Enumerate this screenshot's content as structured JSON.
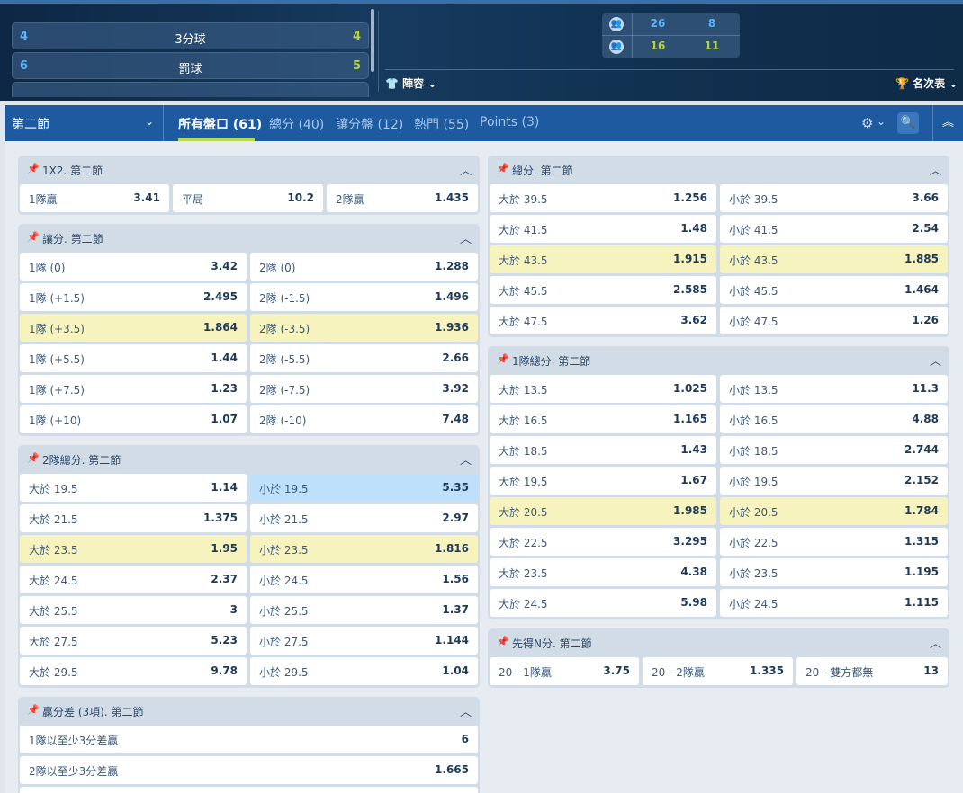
{
  "colors": {
    "nav": "#1d5aa0",
    "active_tab_underline": "#b9d94a",
    "highlight_row": "#f7f3be",
    "selected_cell": "#bfe0fb"
  },
  "stats": [
    {
      "home": "4",
      "label": "3分球",
      "away": "4"
    },
    {
      "home": "6",
      "label": "罰球",
      "away": "5"
    }
  ],
  "scoreboard": {
    "rows": [
      {
        "home": "26",
        "away": "8"
      },
      {
        "home": "16",
        "away": "11"
      }
    ]
  },
  "top_links": {
    "lineup": "陣容",
    "standings": "名次表"
  },
  "nav": {
    "period": "第二節",
    "tabs": [
      "所有盤口 (61)",
      "總分 (40)",
      "讓分盤 (12)",
      "熱門 (55)",
      "Points (3)"
    ]
  },
  "markets": {
    "m1x2": {
      "title": "1X2. 第二節",
      "cells": [
        {
          "n": "1隊贏",
          "o": "3.41"
        },
        {
          "n": "平局",
          "o": "10.2"
        },
        {
          "n": "2隊贏",
          "o": "1.435"
        }
      ]
    },
    "handicap": {
      "title": "讓分. 第二節",
      "rows": [
        [
          {
            "n": "1隊 (0)",
            "o": "3.42"
          },
          {
            "n": "2隊 (0)",
            "o": "1.288"
          }
        ],
        [
          {
            "n": "1隊 (+1.5)",
            "o": "2.495"
          },
          {
            "n": "2隊 (-1.5)",
            "o": "1.496"
          }
        ],
        [
          {
            "n": "1隊 (+3.5)",
            "o": "1.864"
          },
          {
            "n": "2隊 (-3.5)",
            "o": "1.936"
          }
        ],
        [
          {
            "n": "1隊 (+5.5)",
            "o": "1.44"
          },
          {
            "n": "2隊 (-5.5)",
            "o": "2.66"
          }
        ],
        [
          {
            "n": "1隊 (+7.5)",
            "o": "1.23"
          },
          {
            "n": "2隊 (-7.5)",
            "o": "3.92"
          }
        ],
        [
          {
            "n": "1隊 (+10)",
            "o": "1.07"
          },
          {
            "n": "2隊 (-10)",
            "o": "7.48"
          }
        ]
      ]
    },
    "team2_total": {
      "title": "2隊總分. 第二節",
      "rows": [
        [
          {
            "n": "大於 19.5",
            "o": "1.14"
          },
          {
            "n": "小於 19.5",
            "o": "5.35"
          }
        ],
        [
          {
            "n": "大於 21.5",
            "o": "1.375"
          },
          {
            "n": "小於 21.5",
            "o": "2.97"
          }
        ],
        [
          {
            "n": "大於 23.5",
            "o": "1.95"
          },
          {
            "n": "小於 23.5",
            "o": "1.816"
          }
        ],
        [
          {
            "n": "大於 24.5",
            "o": "2.37"
          },
          {
            "n": "小於 24.5",
            "o": "1.56"
          }
        ],
        [
          {
            "n": "大於 25.5",
            "o": "3"
          },
          {
            "n": "小於 25.5",
            "o": "1.37"
          }
        ],
        [
          {
            "n": "大於 27.5",
            "o": "5.23"
          },
          {
            "n": "小於 27.5",
            "o": "1.144"
          }
        ],
        [
          {
            "n": "大於 29.5",
            "o": "9.78"
          },
          {
            "n": "小於 29.5",
            "o": "1.04"
          }
        ]
      ]
    },
    "margin": {
      "title": "贏分差 (3項). 第二節",
      "cells": [
        {
          "n": "1隊以至少3分差贏",
          "o": "6"
        },
        {
          "n": "2隊以至少3分差贏",
          "o": "1.665"
        }
      ]
    },
    "total": {
      "title": "總分. 第二節",
      "rows": [
        [
          {
            "n": "大於 39.5",
            "o": "1.256"
          },
          {
            "n": "小於 39.5",
            "o": "3.66"
          }
        ],
        [
          {
            "n": "大於 41.5",
            "o": "1.48"
          },
          {
            "n": "小於 41.5",
            "o": "2.54"
          }
        ],
        [
          {
            "n": "大於 43.5",
            "o": "1.915"
          },
          {
            "n": "小於 43.5",
            "o": "1.885"
          }
        ],
        [
          {
            "n": "大於 45.5",
            "o": "2.585"
          },
          {
            "n": "小於 45.5",
            "o": "1.464"
          }
        ],
        [
          {
            "n": "大於 47.5",
            "o": "3.62"
          },
          {
            "n": "小於 47.5",
            "o": "1.26"
          }
        ]
      ]
    },
    "team1_total": {
      "title": "1隊總分. 第二節",
      "rows": [
        [
          {
            "n": "大於 13.5",
            "o": "1.025"
          },
          {
            "n": "小於 13.5",
            "o": "11.3"
          }
        ],
        [
          {
            "n": "大於 16.5",
            "o": "1.165"
          },
          {
            "n": "小於 16.5",
            "o": "4.88"
          }
        ],
        [
          {
            "n": "大於 18.5",
            "o": "1.43"
          },
          {
            "n": "小於 18.5",
            "o": "2.744"
          }
        ],
        [
          {
            "n": "大於 19.5",
            "o": "1.67"
          },
          {
            "n": "小於 19.5",
            "o": "2.152"
          }
        ],
        [
          {
            "n": "大於 20.5",
            "o": "1.985"
          },
          {
            "n": "小於 20.5",
            "o": "1.784"
          }
        ],
        [
          {
            "n": "大於 22.5",
            "o": "3.295"
          },
          {
            "n": "小於 22.5",
            "o": "1.315"
          }
        ],
        [
          {
            "n": "大於 23.5",
            "o": "4.38"
          },
          {
            "n": "小於 23.5",
            "o": "1.195"
          }
        ],
        [
          {
            "n": "大於 24.5",
            "o": "5.98"
          },
          {
            "n": "小於 24.5",
            "o": "1.115"
          }
        ]
      ]
    },
    "race": {
      "title": "先得N分. 第二節",
      "cells": [
        {
          "n": "20 - 1隊贏",
          "o": "3.75"
        },
        {
          "n": "20 - 2隊贏",
          "o": "1.335"
        },
        {
          "n": "20 - 雙方都無",
          "o": "13"
        }
      ]
    }
  }
}
